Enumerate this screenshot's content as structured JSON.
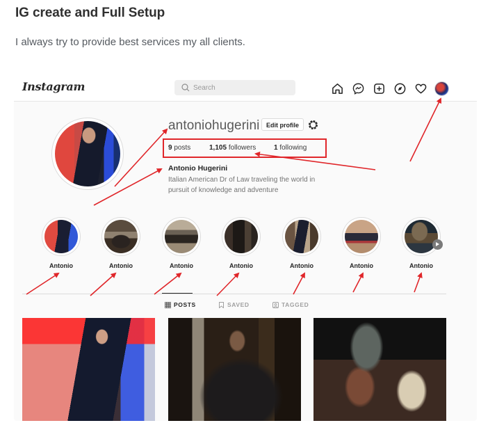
{
  "gig": {
    "title": "IG create and Full Setup",
    "description": "I always try to provide best services my all clients."
  },
  "instagram": {
    "logo": "Instagram",
    "logo_caret_icon": "chevron-down-icon",
    "search": {
      "placeholder": "Search",
      "value": "",
      "icon": "search-icon"
    },
    "nav_icons": [
      "home-icon",
      "messenger-icon",
      "new-post-icon",
      "explore-icon",
      "heart-icon",
      "profile-avatar"
    ],
    "profile": {
      "username": "antoniohugerini",
      "edit_profile_label": "Edit profile",
      "settings_icon": "gear-icon",
      "stats": {
        "posts_count": "9",
        "posts_label": "posts",
        "followers_count": "1,105",
        "followers_label": "followers",
        "following_count": "1",
        "following_label": "following"
      },
      "full_name": "Antonio Hugerini",
      "bio": "Italian American Dr of Law traveling the world in pursuit of knowledge and adventure"
    },
    "highlights": [
      {
        "name": "Antonio"
      },
      {
        "name": "Antonio"
      },
      {
        "name": "Antonio"
      },
      {
        "name": "Antonio"
      },
      {
        "name": "Antonio"
      },
      {
        "name": "Antonio"
      },
      {
        "name": "Antonio"
      }
    ],
    "tabs": [
      {
        "label": "POSTS",
        "icon": "grid-icon",
        "active": true
      },
      {
        "label": "SAVED",
        "icon": "bookmark-icon",
        "active": false
      },
      {
        "label": "TAGGED",
        "icon": "tagged-icon",
        "active": false
      }
    ],
    "posts": [
      {
        "alt": "Man in dark shirt posing in red-lit room"
      },
      {
        "alt": "Man in dark shirt looking upward in dim light"
      },
      {
        "alt": "Group of people with motorcycles at night"
      }
    ]
  },
  "annotation": {
    "arrow_color": "#e0262a"
  }
}
